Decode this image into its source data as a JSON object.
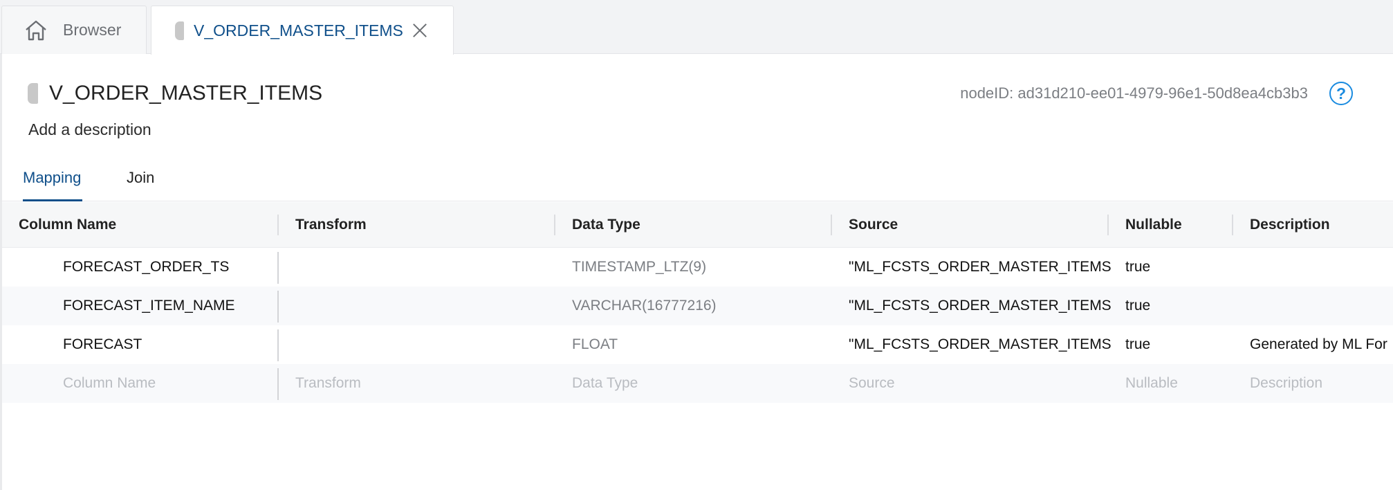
{
  "tabs": {
    "browser_label": "Browser",
    "node_label": "V_ORDER_MASTER_ITEMS"
  },
  "header": {
    "title": "V_ORDER_MASTER_ITEMS",
    "node_id": "nodeID: ad31d210-ee01-4979-96e1-50d8ea4cb3b3",
    "help_glyph": "?",
    "description_placeholder": "Add a description"
  },
  "subtabs": {
    "mapping": "Mapping",
    "join": "Join"
  },
  "table": {
    "headers": {
      "name": "Column Name",
      "transform": "Transform",
      "type": "Data Type",
      "source": "Source",
      "nullable": "Nullable",
      "description": "Description"
    },
    "rows": [
      {
        "name": "FORECAST_ORDER_TS",
        "transform": "",
        "type": "TIMESTAMP_LTZ(9)",
        "source": "\"ML_FCSTS_ORDER_MASTER_ITEMS\".",
        "nullable": "true",
        "description": ""
      },
      {
        "name": "FORECAST_ITEM_NAME",
        "transform": "",
        "type": "VARCHAR(16777216)",
        "source": "\"ML_FCSTS_ORDER_MASTER_ITEMS\".",
        "nullable": "true",
        "description": ""
      },
      {
        "name": "FORECAST",
        "transform": "",
        "type": "FLOAT",
        "source": "\"ML_FCSTS_ORDER_MASTER_ITEMS\".",
        "nullable": "true",
        "description": "Generated by ML For"
      }
    ],
    "new_row": {
      "name": "Column Name",
      "transform": "Transform",
      "type": "Data Type",
      "source": "Source",
      "nullable": "Nullable",
      "description": "Description"
    }
  },
  "colors": {
    "accent": "#0f4f8a",
    "help": "#1a8be0"
  },
  "icons": {
    "home": "home-icon",
    "node": "node-icon",
    "close": "close-icon",
    "help": "help-icon"
  }
}
